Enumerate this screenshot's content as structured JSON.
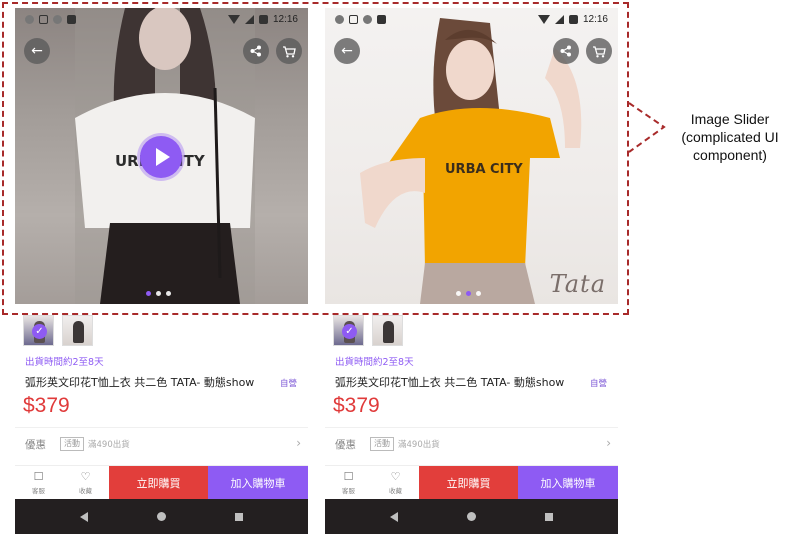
{
  "status_bar": {
    "time": "12:16"
  },
  "phones": [
    {
      "id": "a",
      "shipping_note": "出貨時間約2至8天",
      "product_title": "弧形英文印花T恤上衣 共二色 TATA- 動態show",
      "self_badge": "自營",
      "price": "$379",
      "promo_label": "優惠",
      "promo_tag": "活動",
      "promo_text": "滿490出貨",
      "chevron": "›",
      "service_label": "客服",
      "favorite_label": "收藏",
      "buy_now_label": "立即購買",
      "add_to_cart_label": "加入購物車",
      "slider_dots": 3,
      "active_dot": 0
    },
    {
      "id": "b",
      "shipping_note": "出貨時間約2至8天",
      "product_title": "弧形英文印花T恤上衣 共二色 TATA- 動態show",
      "self_badge": "自營",
      "price": "$379",
      "promo_label": "優惠",
      "promo_tag": "活動",
      "promo_text": "滿490出貨",
      "chevron": "›",
      "service_label": "客服",
      "favorite_label": "收藏",
      "buy_now_label": "立即購買",
      "add_to_cart_label": "加入購物車",
      "watermark": "Tata",
      "slider_dots": 3,
      "active_dot": 1
    }
  ],
  "annotation": {
    "line1": "Image Slider",
    "line2": "(complicated UI",
    "line3": "component)"
  },
  "colors": {
    "accent_purple": "#8e5bf3",
    "buy_red": "#e23e3b",
    "price_red": "#e03a3a",
    "nav_dark": "#231f20",
    "annotation_red": "#a82a2a"
  },
  "icons": [
    "back-arrow-icon",
    "share-icon",
    "cart-icon",
    "play-icon",
    "chat-icon",
    "heart-icon",
    "chevron-right-icon"
  ]
}
